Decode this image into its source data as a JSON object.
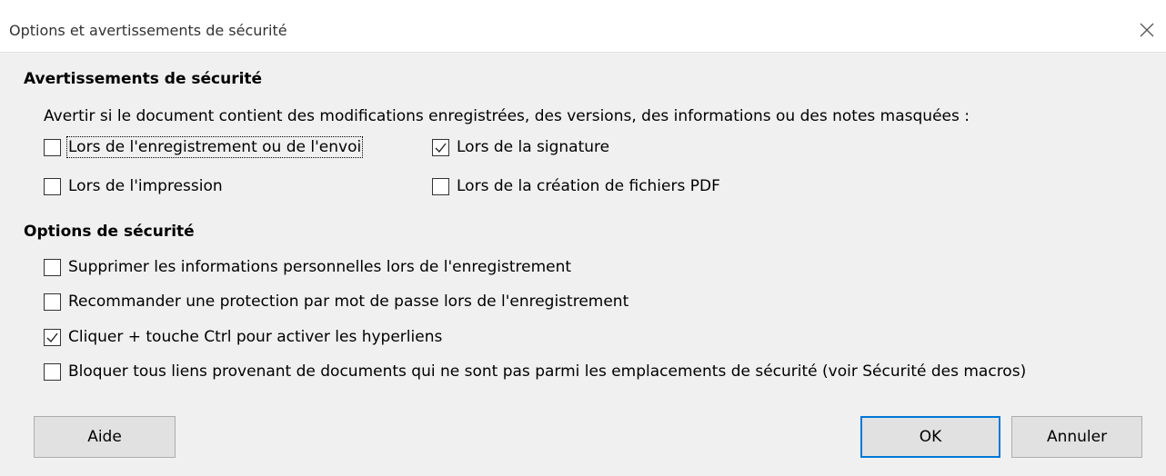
{
  "window": {
    "title": "Options et avertissements de sécurité"
  },
  "warnings": {
    "title": "Avertissements de sécurité",
    "description": "Avertir si le document contient des modifications enregistrées, des versions, des informations ou des notes masquées :",
    "items": [
      {
        "label": "Lors de l'enregistrement ou de l'envoi",
        "checked": false
      },
      {
        "label": "Lors de la signature",
        "checked": true
      },
      {
        "label": "Lors de l'impression",
        "checked": false
      },
      {
        "label": "Lors de la création de fichiers PDF",
        "checked": false
      }
    ]
  },
  "options": {
    "title": "Options de sécurité",
    "items": [
      {
        "label": "Supprimer les informations personnelles lors de l'enregistrement",
        "checked": false
      },
      {
        "label": "Recommander une protection par mot de passe lors de l'enregistrement",
        "checked": false
      },
      {
        "label": "Cliquer + touche Ctrl pour activer les hyperliens",
        "checked": true
      },
      {
        "label": "Bloquer tous liens provenant de documents qui ne sont pas parmi les emplacements de sécurité (voir Sécurité des macros)",
        "checked": false
      }
    ]
  },
  "buttons": {
    "help": "Aide",
    "ok": "OK",
    "cancel": "Annuler"
  },
  "icons": {
    "close": "close-icon",
    "check": "check-icon"
  },
  "colors": {
    "accent": "#0078d7",
    "background": "#f0f0f0"
  }
}
